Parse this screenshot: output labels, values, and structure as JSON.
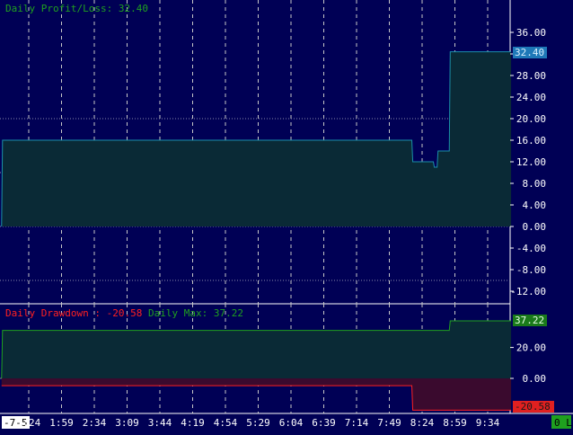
{
  "profit_panel": {
    "title_label": "Daily Profit/Loss:",
    "title_value": "32.40",
    "current_badge": "32.40",
    "badge_color": "#1e78b8",
    "line_color": "#1b8fa8",
    "fill_color": "#0a2a36",
    "y_ticks": [
      "36.00",
      "32.00",
      "28.00",
      "24.00",
      "20.00",
      "16.00",
      "12.00",
      "8.00",
      "4.00",
      "0.00",
      "-4.00",
      "-8.00",
      "-12.00"
    ]
  },
  "drawdown_panel": {
    "drawdown_label": "Daily Drawdown :",
    "drawdown_value": "-20.58",
    "max_label": "Daily Max:",
    "max_value": "37.22",
    "drawdown_color": "#ff2020",
    "max_color": "#1fa01f",
    "max_badge": "37.22",
    "drawdown_badge": "-20.58",
    "y_ticks": [
      "20.00",
      "0.00"
    ]
  },
  "x_axis": {
    "first_label": "-7-5",
    "labels": [
      "1:24",
      "1:59",
      "2:34",
      "3:09",
      "3:44",
      "4:19",
      "4:54",
      "5:29",
      "6:04",
      "6:39",
      "7:14",
      "7:49",
      "8:24",
      "8:59",
      "9:34"
    ]
  },
  "corner_badge": "0 L",
  "chart_data": [
    {
      "type": "area",
      "title": "Daily Profit/Loss: 32.40",
      "ylim": [
        -13,
        40
      ],
      "x_ticks": [
        "1:24",
        "1:59",
        "2:34",
        "3:09",
        "3:44",
        "4:19",
        "4:54",
        "5:29",
        "6:04",
        "6:39",
        "7:14",
        "7:49",
        "8:24",
        "8:59",
        "9:34"
      ],
      "series": [
        {
          "name": "Daily Profit/Loss",
          "x": [
            "0:55",
            "0:56",
            "8:13",
            "8:14",
            "8:36",
            "8:37",
            "8:40",
            "8:41",
            "8:53",
            "8:54",
            "9:59"
          ],
          "values": [
            0,
            16,
            16,
            12,
            12,
            11,
            11,
            14,
            14,
            32.4,
            32.4
          ]
        }
      ]
    },
    {
      "type": "area",
      "ylim": [
        -27,
        48
      ],
      "series": [
        {
          "name": "Daily Max",
          "x": [
            "0:55",
            "0:56",
            "8:53",
            "8:54",
            "9:59"
          ],
          "values": [
            0,
            31,
            31,
            37.22,
            37.22
          ]
        },
        {
          "name": "Daily Drawdown",
          "x": [
            "0:55",
            "8:13",
            "8:14",
            "9:59"
          ],
          "values": [
            -4.7,
            -4.7,
            -20.58,
            -20.58
          ]
        }
      ]
    }
  ]
}
